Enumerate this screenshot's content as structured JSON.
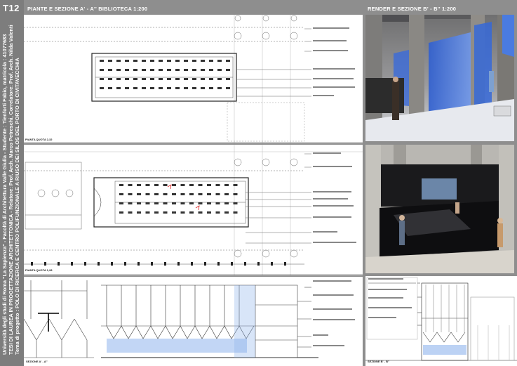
{
  "board": {
    "code": "T12",
    "title_lines": [
      "Università degli studi di Roma \"La Sapienza\" - Facoltà di Architettura Valle Giulia - Studente : Tienforti Fabio, matricola : 41077683",
      "TESI DI LAUREA IN PROGETTAZIONE ARCHITETTONICA - Relatore: Prof. Arch. Marco Petreschi, Correlatore: Prof. Arch. Nilda Valentin",
      "Tema di progetto : POLO DI RICERCA E CENTRO POLIFUNZIONALE A RIUSO DEI SILOS DEL PORTO DI CIVITAVECCHIA"
    ]
  },
  "headers": {
    "left": "PIANTE E SEZIONE A' - A''  BIBLIOTECA 1:200",
    "right": "RENDER E SEZIONE B' - B'' 1:200"
  },
  "labels": {
    "plan_1": "PIANTA QUOTA  2,32",
    "plan_2": "PIANTA QUOTA  1,28",
    "section_a": "SEZIONE A' - A''",
    "section_b": "SEZIONE B' - B''"
  },
  "colors": {
    "board": "#8e8e8e",
    "sidebar": "#7d7d7d",
    "glass_blue": "#3f6fd8"
  }
}
